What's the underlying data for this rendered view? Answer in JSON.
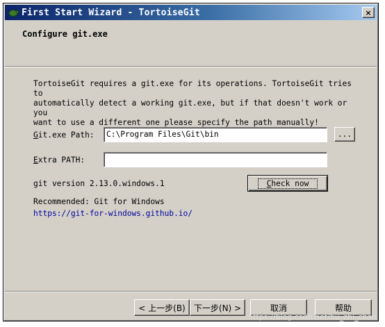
{
  "window": {
    "title": "First Start Wizard - TortoiseGit",
    "close_glyph": "×",
    "title_icon": "tortoise-icon"
  },
  "header": {
    "title": "Configure git.exe"
  },
  "content": {
    "description_lines": [
      "TortoiseGit requires a git.exe for its operations. TortoiseGit tries to",
      "automatically detect a working git.exe, but if that doesn't work or you",
      "want to use a different one please specify the path manually!"
    ],
    "git_path": {
      "label_accel": "G",
      "label_rest": "it.exe Path:",
      "value": "C:\\Program Files\\Git\\bin",
      "browse_label": "..."
    },
    "extra_path": {
      "label_accel": "E",
      "label_rest": "xtra PATH:",
      "value": ""
    },
    "version_text": "git version 2.13.0.windows.1",
    "check_button": {
      "label_accel": "C",
      "label_rest": "heck now"
    },
    "recommended_text": "Recommended: Git for Windows",
    "link_text": "https://git-for-windows.github.io/"
  },
  "footer": {
    "back_label": "< 上一步(B)",
    "next_label": "下一步(N) >",
    "cancel_label": "取消",
    "help_label": "帮助"
  },
  "watermark": "https://blog.csdn.net/hu_zhi_chao",
  "colors": {
    "dialog_bg": "#d4d0c8",
    "title_start": "#0a246a",
    "title_end": "#a6caf0",
    "link": "#0000a0"
  }
}
